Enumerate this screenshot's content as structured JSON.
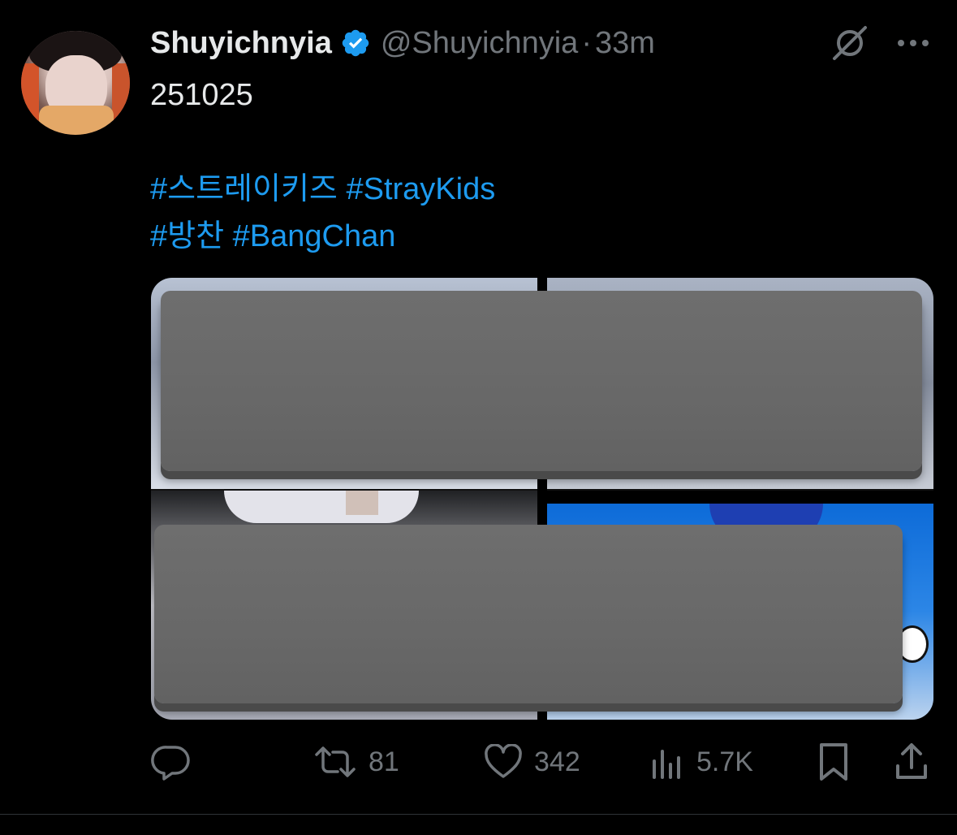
{
  "tweet": {
    "author": {
      "display_name": "Shuyichnyia",
      "handle": "@Shuyichnyia",
      "verified": true,
      "avatar_icon": "profile-photo"
    },
    "time": "33m",
    "separator": "·",
    "text_line1": "251025",
    "hashtags_line1": [
      "#스트레이키즈",
      "#StrayKids"
    ],
    "hashtags_line2": [
      "#방찬",
      "#BangChan"
    ],
    "media": {
      "tiles": 4,
      "redacted": true
    }
  },
  "actions": {
    "reply": {
      "icon": "reply-icon",
      "count": ""
    },
    "retweet": {
      "icon": "retweet-icon",
      "count": "81"
    },
    "like": {
      "icon": "heart-icon",
      "count": "342"
    },
    "views": {
      "icon": "views-icon",
      "count": "5.7K"
    },
    "bookmark": {
      "icon": "bookmark-icon"
    },
    "share": {
      "icon": "share-icon"
    }
  },
  "colors": {
    "background": "#000000",
    "text": "#e7e9ea",
    "muted": "#71767b",
    "link": "#1d9bf0",
    "verified": "#1d9bf0"
  }
}
